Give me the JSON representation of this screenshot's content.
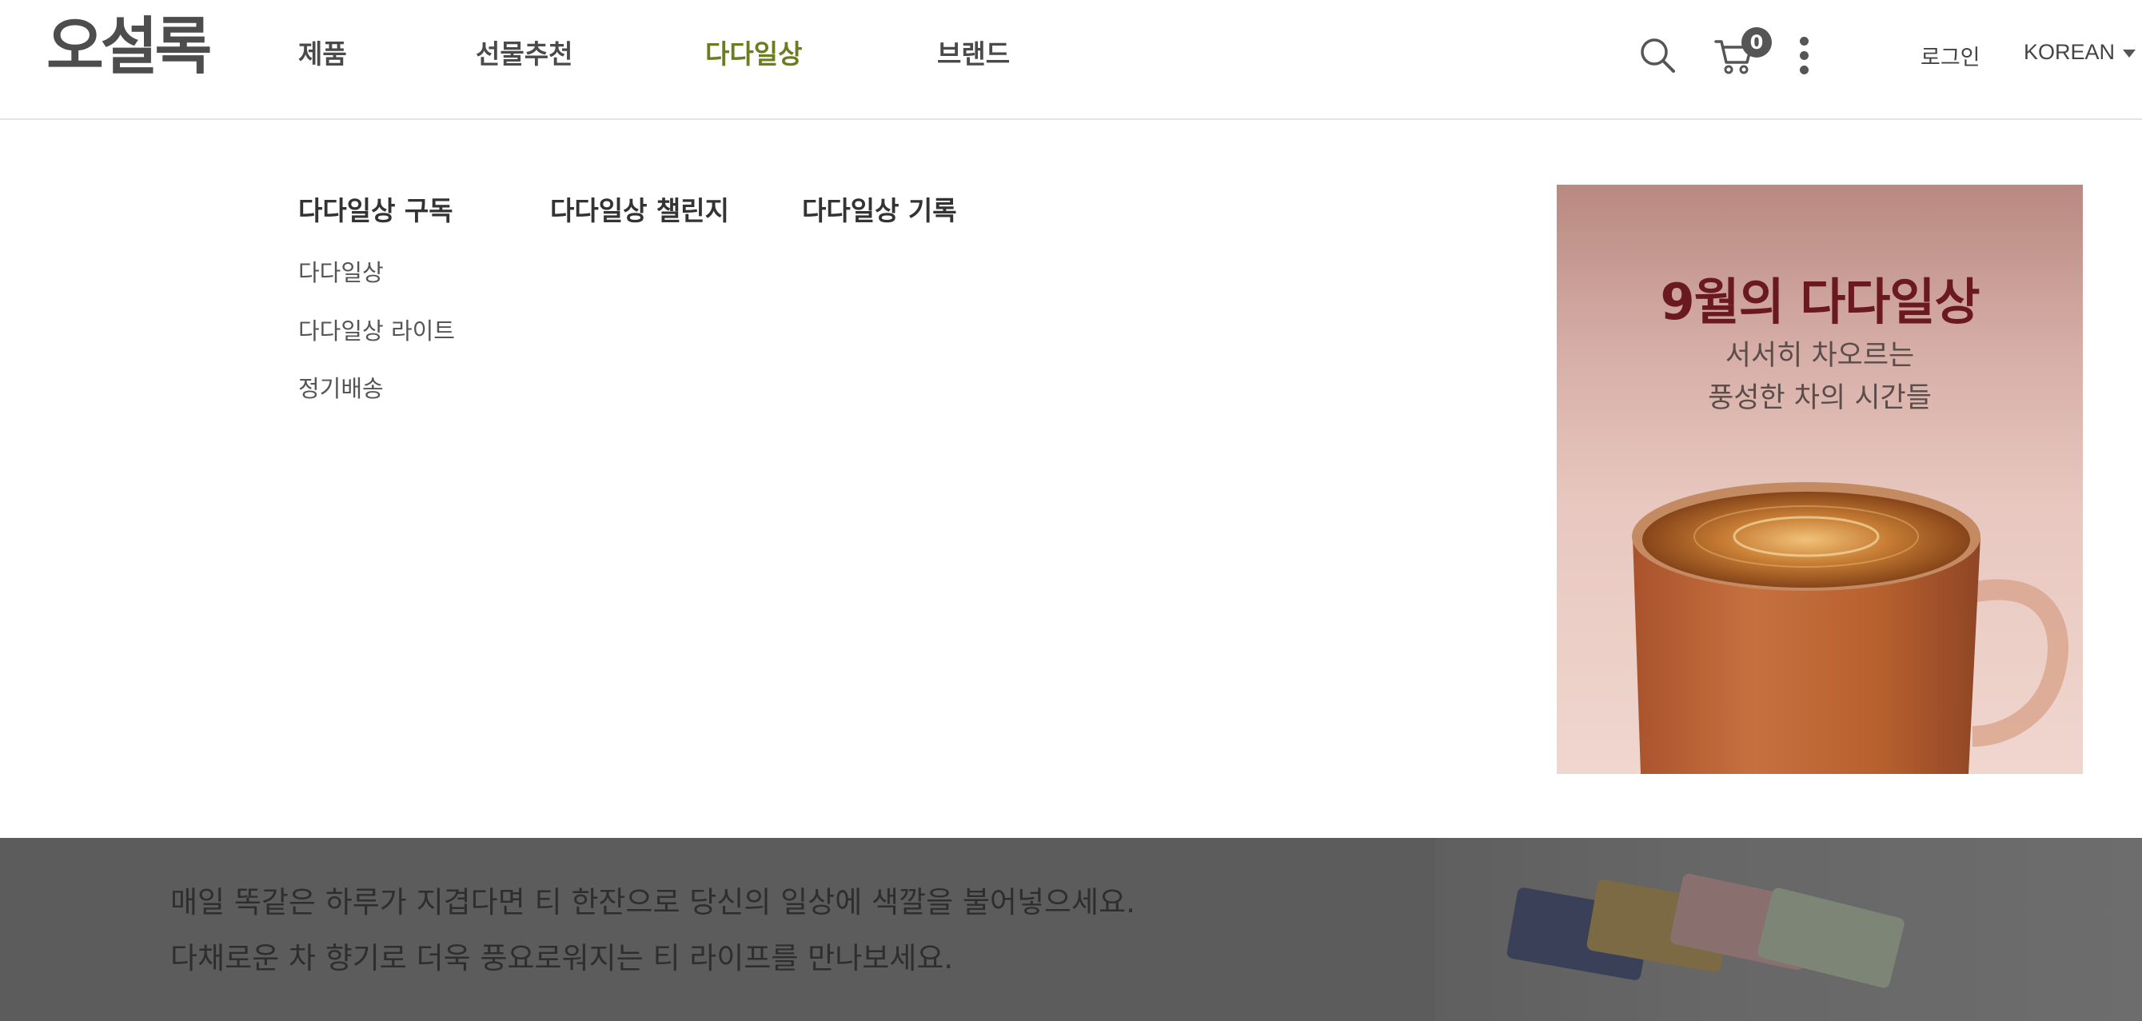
{
  "header": {
    "logo_text": "오설록",
    "nav": [
      {
        "label": "제품",
        "active": false
      },
      {
        "label": "선물추천",
        "active": false
      },
      {
        "label": "다다일상",
        "active": true
      },
      {
        "label": "브랜드",
        "active": false
      }
    ],
    "cart_count": "0",
    "login_label": "로그인",
    "language_label": "KOREAN",
    "icons": [
      "search-icon",
      "cart-icon",
      "more-vertical-icon",
      "chevron-down-icon"
    ]
  },
  "mega_menu": {
    "columns": [
      {
        "title": "다다일상 구독",
        "items": [
          "다다일상",
          "다다일상 라이트",
          "정기배송"
        ]
      },
      {
        "title": "다다일상 챌린지",
        "items": []
      },
      {
        "title": "다다일상 기록",
        "items": []
      }
    ],
    "promo": {
      "title": "9월의 다다일상",
      "subtitle_line1": "서서히 차오르는",
      "subtitle_line2": "풍성한 차의 시간들"
    }
  },
  "background_section": {
    "line1": "매일 똑같은 하루가 지겹다면 티 한잔으로 당신의 일상에 색깔을 불어넣으세요.",
    "line2": "다채로운 차 향기로 더욱 풍요로워지는 티 라이프를 만나보세요."
  },
  "colors": {
    "active_nav": "#6b7d1f",
    "promo_title": "#6a1a1f",
    "overlay": "#5c5c5c"
  }
}
